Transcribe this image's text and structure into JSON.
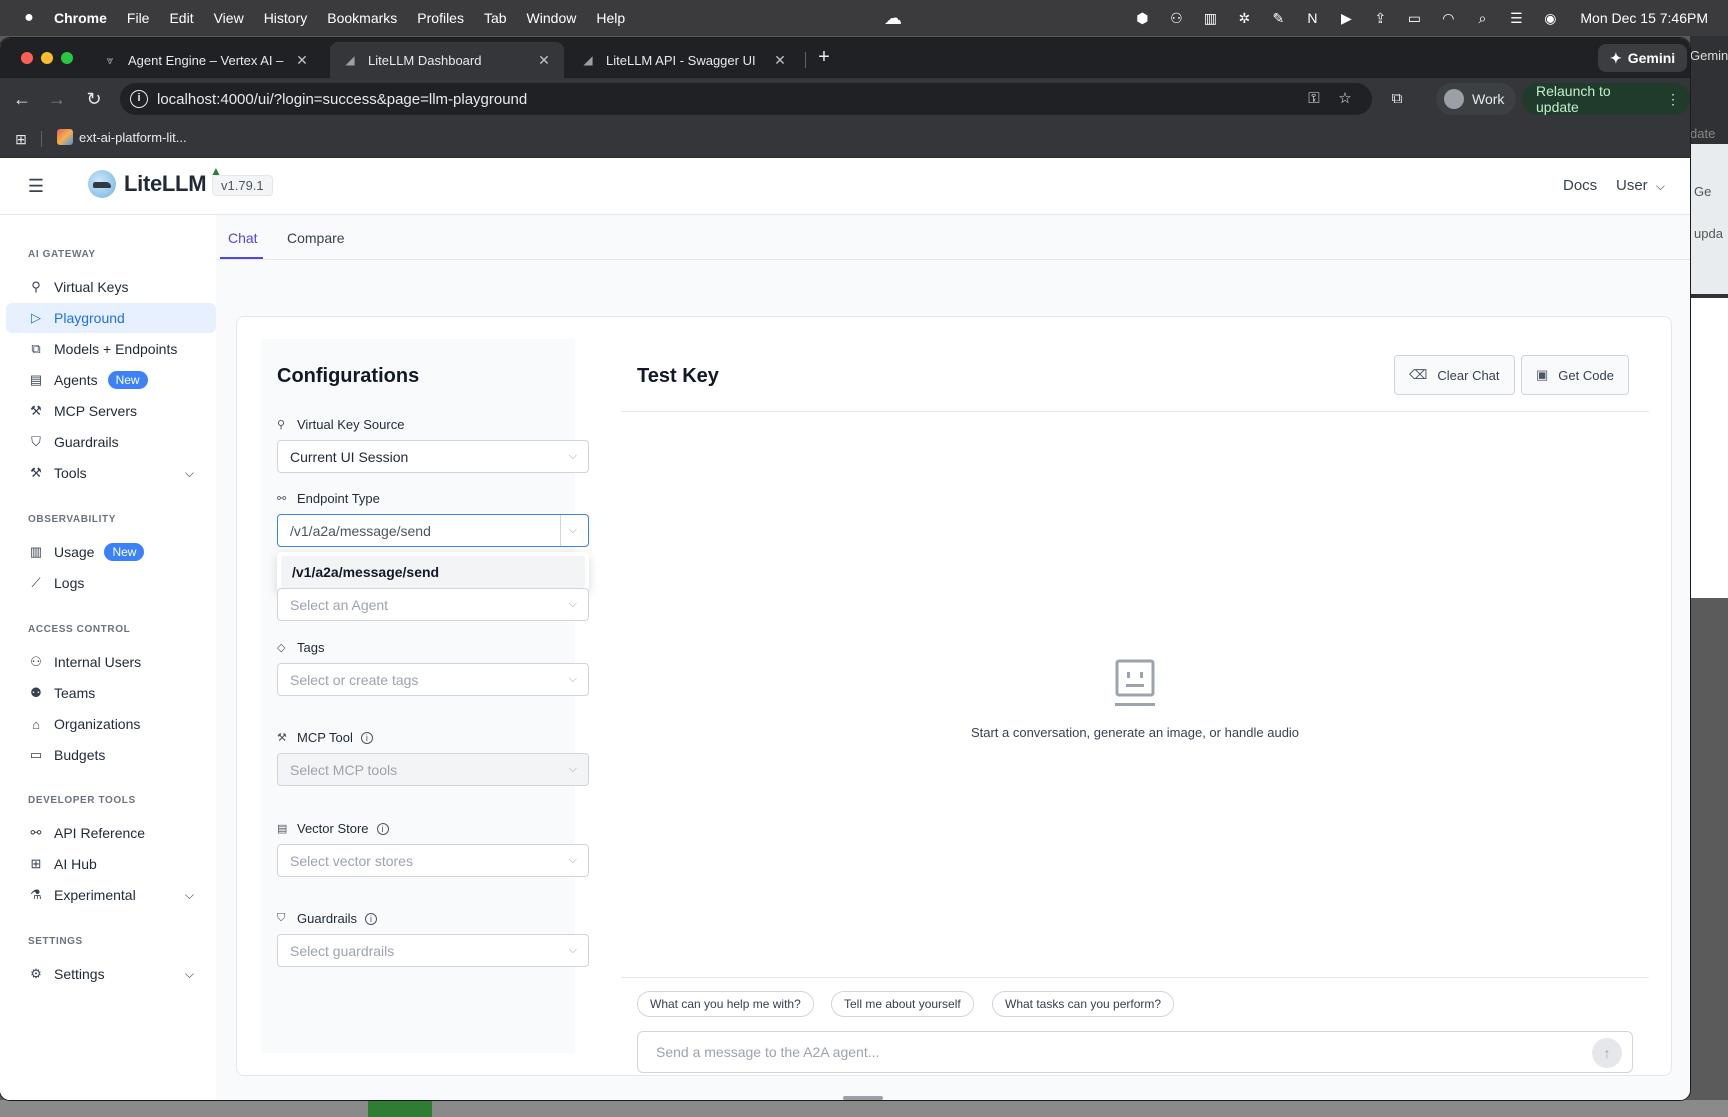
{
  "menubar": {
    "app": "Chrome",
    "items": [
      "File",
      "Edit",
      "View",
      "History",
      "Bookmarks",
      "Profiles",
      "Tab",
      "Window",
      "Help"
    ],
    "clock": "Mon Dec 15  7:46PM"
  },
  "browser": {
    "tabs": [
      {
        "label": "Agent Engine – Vertex AI – lit",
        "icon": "vertex-icon"
      },
      {
        "label": "LiteLLM Dashboard",
        "icon": "litellm-icon"
      },
      {
        "label": "LiteLLM API - Swagger UI",
        "icon": "litellm-icon"
      }
    ],
    "gemini_label": "Gemini",
    "url": "localhost:4000/ui/?login=success&page=llm-playground",
    "profile_label": "Work",
    "relaunch_label": "Relaunch to update",
    "bookmark": "ext-ai-platform-lit..."
  },
  "background_windows": {
    "gemini_label": "Gemini",
    "update_label": "date",
    "pane_label_1": "Ge",
    "pane_label_2": "upda"
  },
  "header": {
    "logo_text": "LiteLLM",
    "version": "v1.79.1",
    "docs": "Docs",
    "user": "User"
  },
  "sidebar": {
    "sections": [
      {
        "title": "AI GATEWAY",
        "items": [
          {
            "label": "Virtual Keys",
            "icon": "key-icon"
          },
          {
            "label": "Playground",
            "icon": "play-icon",
            "active": true
          },
          {
            "label": "Models + Endpoints",
            "icon": "models-icon"
          },
          {
            "label": "Agents",
            "icon": "agents-icon",
            "badge": "New"
          },
          {
            "label": "MCP Servers",
            "icon": "tool-icon"
          },
          {
            "label": "Guardrails",
            "icon": "shield-icon"
          },
          {
            "label": "Tools",
            "icon": "tool-icon",
            "expandable": true
          }
        ]
      },
      {
        "title": "OBSERVABILITY",
        "items": [
          {
            "label": "Usage",
            "icon": "bar-chart-icon",
            "badge": "New"
          },
          {
            "label": "Logs",
            "icon": "line-chart-icon"
          }
        ]
      },
      {
        "title": "ACCESS CONTROL",
        "items": [
          {
            "label": "Internal Users",
            "icon": "user-icon"
          },
          {
            "label": "Teams",
            "icon": "team-icon"
          },
          {
            "label": "Organizations",
            "icon": "bank-icon"
          },
          {
            "label": "Budgets",
            "icon": "wallet-icon"
          }
        ]
      },
      {
        "title": "DEVELOPER TOOLS",
        "items": [
          {
            "label": "API Reference",
            "icon": "api-icon"
          },
          {
            "label": "AI Hub",
            "icon": "grid-icon"
          },
          {
            "label": "Experimental",
            "icon": "flask-icon",
            "expandable": true
          }
        ]
      },
      {
        "title": "SETTINGS",
        "items": [
          {
            "label": "Settings",
            "icon": "gear-icon",
            "expandable": true
          }
        ]
      }
    ]
  },
  "subtabs": {
    "chat": "Chat",
    "compare": "Compare"
  },
  "config": {
    "title": "Configurations",
    "virtual_key_source": {
      "label": "Virtual Key Source",
      "value": "Current UI Session"
    },
    "endpoint_type": {
      "label": "Endpoint Type",
      "value": "/v1/a2a/message/send",
      "dropdown_option": "/v1/a2a/message/send"
    },
    "agent": {
      "placeholder": "Select an Agent"
    },
    "tags": {
      "label": "Tags",
      "placeholder": "Select or create tags"
    },
    "mcp_tool": {
      "label": "MCP Tool",
      "placeholder": "Select MCP tools"
    },
    "vector_store": {
      "label": "Vector Store",
      "placeholder": "Select vector stores"
    },
    "guardrails": {
      "label": "Guardrails",
      "placeholder": "Select guardrails"
    }
  },
  "chat": {
    "title": "Test Key",
    "clear_chat": "Clear Chat",
    "get_code": "Get Code",
    "empty_text": "Start a conversation, generate an image, or handle audio",
    "suggestions": [
      "What can you help me with?",
      "Tell me about yourself",
      "What tasks can you perform?"
    ],
    "input_placeholder": "Send a message to the A2A agent..."
  },
  "colors": {
    "accent": "#4f46e5",
    "active_nav_bg": "#e6f0ff",
    "badge": "#3b82f6"
  }
}
